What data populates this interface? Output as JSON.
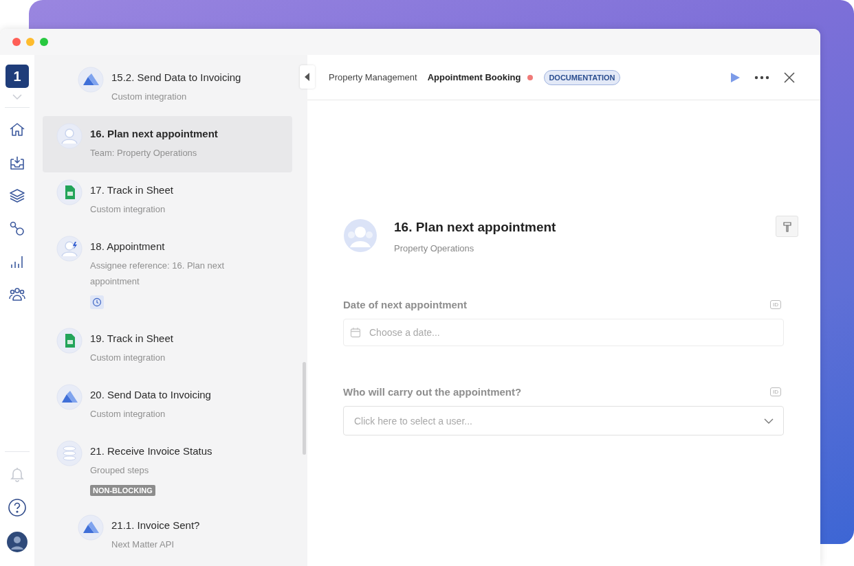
{
  "rail": {
    "workspace": "1"
  },
  "steps": [
    {
      "children": [
        {
          "title": "15.2. Send Data to Invoicing",
          "subtitle": "Custom integration",
          "kind": "integration",
          "selected": false
        }
      ]
    },
    {
      "title": "16. Plan next appointment",
      "subtitle": "Team: Property Operations",
      "kind": "team",
      "selected": true
    },
    {
      "title": "17. Track in Sheet",
      "subtitle": "Custom integration",
      "kind": "sheet",
      "selected": false
    },
    {
      "title": "18. Appointment",
      "subtitle": "Assignee reference: 16. Plan next appointment",
      "kind": "assignee",
      "selected": false,
      "tags": [
        {
          "kind": "clock"
        }
      ]
    },
    {
      "title": "19. Track in Sheet",
      "subtitle": "Custom integration",
      "kind": "sheet",
      "selected": false
    },
    {
      "title": "20. Send Data to Invoicing",
      "subtitle": "Custom integration",
      "kind": "integration",
      "selected": false
    },
    {
      "title": "21. Receive Invoice Status",
      "subtitle": "Grouped steps",
      "kind": "group",
      "selected": false,
      "tags": [
        {
          "kind": "label",
          "text": "NON-BLOCKING"
        }
      ],
      "children": [
        {
          "title": "21.1. Invoice Sent?",
          "subtitle": "Next Matter API",
          "kind": "integration",
          "selected": false
        }
      ]
    }
  ],
  "header": {
    "breadcrumb": [
      "Property Management",
      "Appointment Booking"
    ],
    "unsaved": true,
    "badge": "DOCUMENTATION"
  },
  "step": {
    "title": "16. Plan next appointment",
    "subtitle": "Property Operations"
  },
  "fields": [
    {
      "label": "Date of next appointment",
      "id_badge": "ID",
      "kind": "date",
      "placeholder": "Choose a date..."
    },
    {
      "label": "Who will carry out the appointment?",
      "id_badge": "ID",
      "kind": "select",
      "placeholder": "Click here to select a user..."
    }
  ]
}
